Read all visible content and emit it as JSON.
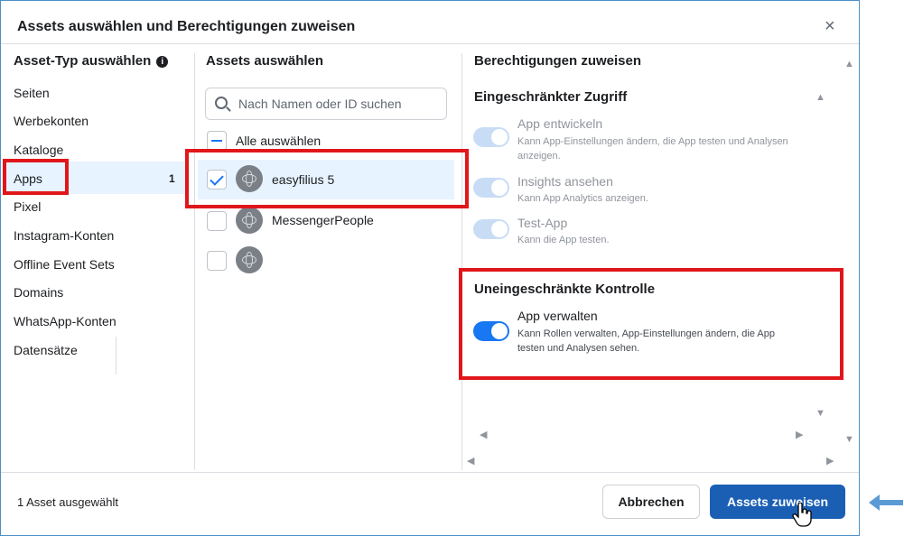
{
  "dialog": {
    "title": "Assets auswählen und Berechtigungen zuweisen",
    "close_glyph": "×"
  },
  "asset_types": {
    "title": "Asset-Typ auswählen",
    "info_glyph": "i",
    "items": [
      {
        "label": "Seiten"
      },
      {
        "label": "Werbekonten"
      },
      {
        "label": "Kataloge"
      },
      {
        "label": "Apps",
        "count": "1"
      },
      {
        "label": "Pixel"
      },
      {
        "label": "Instagram-Konten"
      },
      {
        "label": "Offline Event Sets"
      },
      {
        "label": "Domains"
      },
      {
        "label": "WhatsApp-Konten"
      },
      {
        "label": "Datensätze"
      }
    ],
    "selected": "Apps"
  },
  "assets": {
    "title": "Assets auswählen",
    "search_placeholder": "Nach Namen oder ID suchen",
    "select_all_label": "Alle auswählen",
    "items": [
      {
        "name": "easyfilius 5",
        "checked": true
      },
      {
        "name": "MessengerPeople",
        "checked": false
      },
      {
        "name": "",
        "checked": false
      }
    ]
  },
  "permissions": {
    "title": "Berechtigungen zuweisen",
    "restricted": {
      "title": "Eingeschränkter Zugriff",
      "items": [
        {
          "name": "App entwickeln",
          "desc": "Kann App-Einstellungen ändern, die App testen und Analysen anzeigen."
        },
        {
          "name": "Insights ansehen",
          "desc": "Kann App Analytics anzeigen."
        },
        {
          "name": "Test-App",
          "desc": "Kann die App testen."
        }
      ]
    },
    "full": {
      "title": "Uneingeschränkte Kontrolle",
      "items": [
        {
          "name": "App verwalten",
          "desc": "Kann Rollen verwalten, App-Einstellungen ändern, die App testen und Analysen sehen.",
          "on": true
        }
      ]
    }
  },
  "footer": {
    "selection_count": "1 Asset ausgewählt",
    "cancel_label": "Abbrechen",
    "assign_label": "Assets zuweisen"
  },
  "colors": {
    "accent": "#1877f2",
    "primary_button": "#1b5fb4",
    "highlight": "#e0161b",
    "selected_bg": "#e7f3ff"
  }
}
